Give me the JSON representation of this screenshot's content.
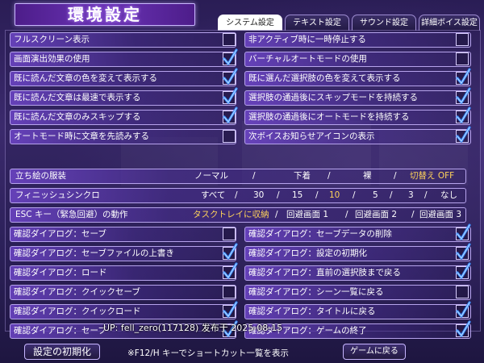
{
  "header": {
    "title": "環境設定"
  },
  "tabs": [
    {
      "label": "システム設定",
      "active": true
    },
    {
      "label": "テキスト設定",
      "active": false
    },
    {
      "label": "サウンド設定",
      "active": false
    },
    {
      "label": "詳細ボイス設定",
      "active": false
    }
  ],
  "left_options": [
    {
      "label": "フルスクリーン表示",
      "checked": false
    },
    {
      "label": "画面演出効果の使用",
      "checked": true
    },
    {
      "label": "既に読んだ文章の色を変えて表示する",
      "checked": true
    },
    {
      "label": "既に読んだ文章は最速で表示する",
      "checked": true
    },
    {
      "label": "既に読んだ文章のみスキップする",
      "checked": true
    },
    {
      "label": "オートモード時に文章を先読みする",
      "checked": false
    }
  ],
  "right_options": [
    {
      "label": "非アクティブ時に一時停止する",
      "checked": false
    },
    {
      "label": "バーチャルオートモードの使用",
      "checked": false
    },
    {
      "label": "既に選んだ選択肢の色を変えて表示する",
      "checked": true
    },
    {
      "label": "選択肢の通過後にスキップモードを持続する",
      "checked": true
    },
    {
      "label": "選択肢の通過後にオートモードを持続する",
      "checked": true
    },
    {
      "label": "次ボイスお知らせアイコンの表示",
      "checked": true
    }
  ],
  "costume": {
    "label": "立ち絵の服装",
    "options": [
      "ノーマル",
      "下着",
      "裸",
      "切替え OFF"
    ],
    "selected_index": 3
  },
  "finish_sync": {
    "label": "フィニッシュシンクロ",
    "options": [
      "すべて",
      "30",
      "15",
      "10",
      "5",
      "3",
      "なし"
    ],
    "selected_index": 3
  },
  "esc_action": {
    "label": "ESC キー（緊急回避）の動作",
    "options": [
      "タスクトレイに収納",
      "回避画面 1",
      "回避画面 2",
      "回避画面 3"
    ],
    "selected_index": 0
  },
  "confirm_left": [
    {
      "label": "確認ダイアログ：セーブ",
      "checked": false
    },
    {
      "label": "確認ダイアログ：セーブファイルの上書き",
      "checked": true
    },
    {
      "label": "確認ダイアログ：ロード",
      "checked": true
    },
    {
      "label": "確認ダイアログ：クイックセーブ",
      "checked": false
    },
    {
      "label": "確認ダイアログ：クイックロード",
      "checked": true
    },
    {
      "label": "確認ダイアログ：セーブ",
      "checked": true
    }
  ],
  "confirm_right": [
    {
      "label": "確認ダイアログ：セーブデータの削除",
      "checked": true
    },
    {
      "label": "確認ダイアログ：設定の初期化",
      "checked": true
    },
    {
      "label": "確認ダイアログ：直前の選択肢まで戻る",
      "checked": true
    },
    {
      "label": "確認ダイアログ：シーン一覧に戻る",
      "checked": false
    },
    {
      "label": "確認ダイアログ：タイトルに戻る",
      "checked": true
    },
    {
      "label": "確認ダイアログ：ゲームの終了",
      "checked": true
    }
  ],
  "footer": {
    "reset_label": "設定の初期化",
    "note": "※F12/H キーでショートカット一覧を表示",
    "back_label": "ゲームに戻る"
  },
  "watermark": "UP: fell_zero(117128) 发布于 2025-08-15",
  "colors": {
    "highlight": "#ffd35a",
    "check": "#3a8bff",
    "panel": "#3b2a6d"
  }
}
